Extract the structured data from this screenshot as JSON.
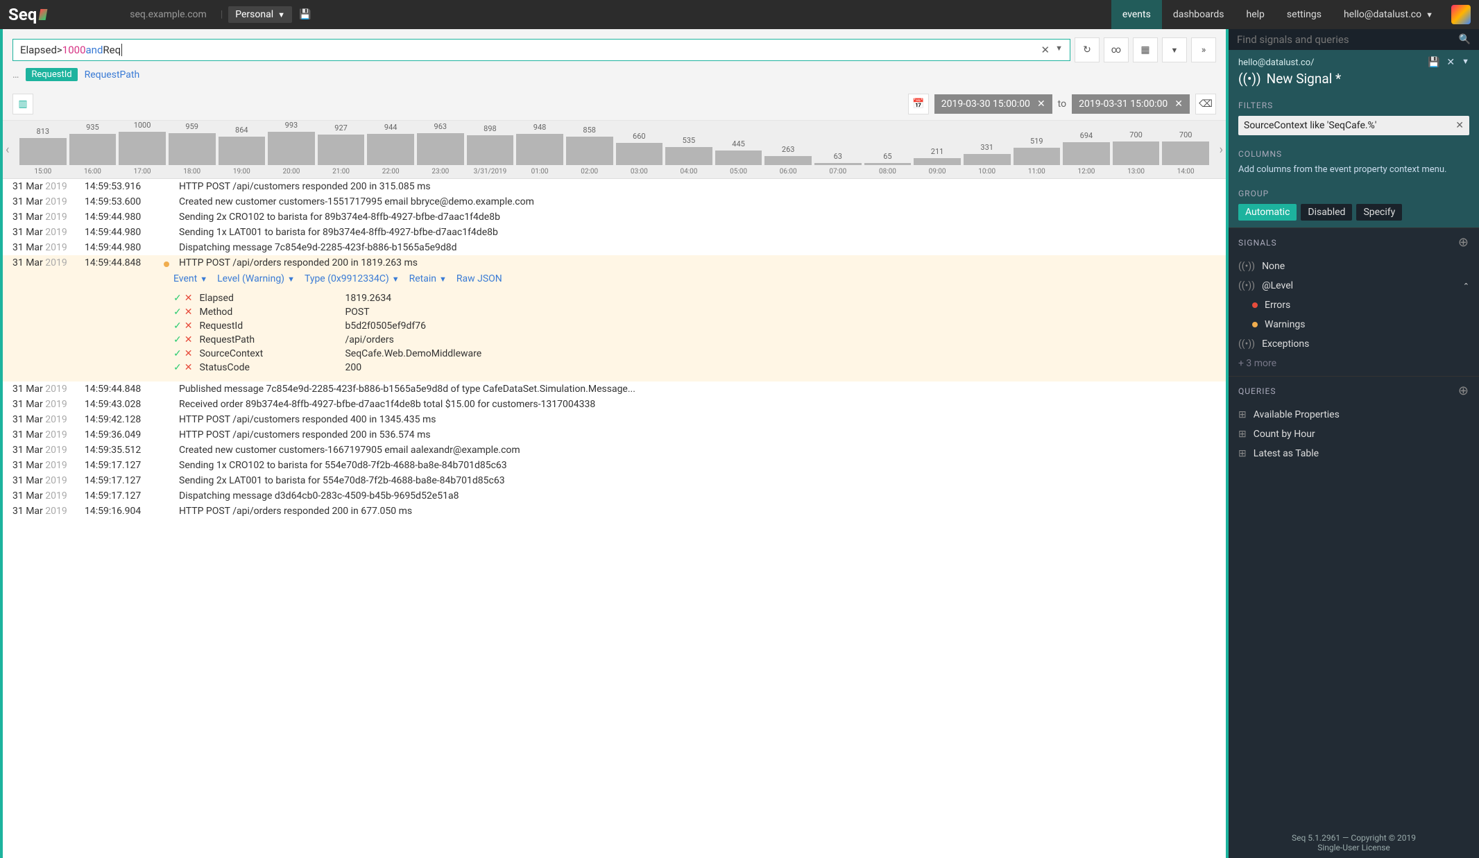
{
  "topnav": {
    "brand": "Seq",
    "host": "seq.example.com",
    "workspace": "Personal",
    "links": [
      "events",
      "dashboards",
      "help",
      "settings"
    ],
    "user": "hello@datalust.co"
  },
  "search": {
    "tokens": {
      "t1": "Elapsed ",
      "op": "> ",
      "num": "1000",
      "and": " and ",
      "t2": "Req"
    },
    "chips": {
      "pill": "RequestId",
      "link": "RequestPath"
    }
  },
  "dates": {
    "from": "2019-03-30 15:00:00",
    "to_label": "to",
    "to": "2019-03-31 15:00:00"
  },
  "chart_data": {
    "type": "bar",
    "categories": [
      "15:00",
      "16:00",
      "17:00",
      "18:00",
      "19:00",
      "20:00",
      "21:00",
      "22:00",
      "23:00",
      "3/31/2019",
      "01:00",
      "02:00",
      "03:00",
      "04:00",
      "05:00",
      "06:00",
      "07:00",
      "08:00",
      "09:00",
      "10:00",
      "11:00",
      "12:00",
      "13:00",
      "14:00"
    ],
    "values": [
      813,
      935,
      1000,
      959,
      864,
      993,
      927,
      944,
      963,
      898,
      948,
      858,
      660,
      535,
      445,
      263,
      63,
      65,
      211,
      331,
      519,
      694,
      700,
      700
    ],
    "title": "",
    "xlabel": "",
    "ylabel": "",
    "ylim": [
      0,
      1000
    ]
  },
  "events": [
    {
      "date": "31 Mar",
      "year": "2019",
      "time": "14:59:53.916",
      "level": null,
      "msg": "HTTP POST /api/customers responded 200 in 315.085 ms"
    },
    {
      "date": "31 Mar",
      "year": "2019",
      "time": "14:59:53.600",
      "level": null,
      "msg": "Created new customer customers-1551717995 email bbryce@demo.example.com"
    },
    {
      "date": "31 Mar",
      "year": "2019",
      "time": "14:59:44.980",
      "level": null,
      "msg": "Sending 2x CRO102 to barista for 89b374e4-8ffb-4927-bfbe-d7aac1f4de8b"
    },
    {
      "date": "31 Mar",
      "year": "2019",
      "time": "14:59:44.980",
      "level": null,
      "msg": "Sending 1x LAT001 to barista for 89b374e4-8ffb-4927-bfbe-d7aac1f4de8b"
    },
    {
      "date": "31 Mar",
      "year": "2019",
      "time": "14:59:44.980",
      "level": null,
      "msg": "Dispatching message 7c854e9d-2285-423f-b886-b1565a5e9d8d"
    },
    {
      "date": "31 Mar",
      "year": "2019",
      "time": "14:59:44.848",
      "level": "warn",
      "msg": "HTTP POST /api/orders responded 200 in 1819.263 ms",
      "expanded": true
    },
    {
      "date": "31 Mar",
      "year": "2019",
      "time": "14:59:44.848",
      "level": null,
      "msg": "Published message 7c854e9d-2285-423f-b886-b1565a5e9d8d of type CafeDataSet.Simulation.Message..."
    },
    {
      "date": "31 Mar",
      "year": "2019",
      "time": "14:59:43.028",
      "level": null,
      "msg": "Received order 89b374e4-8ffb-4927-bfbe-d7aac1f4de8b total $15.00 for customers-1317004338"
    },
    {
      "date": "31 Mar",
      "year": "2019",
      "time": "14:59:42.128",
      "level": null,
      "msg": "HTTP POST /api/customers responded 400 in 1345.435 ms"
    },
    {
      "date": "31 Mar",
      "year": "2019",
      "time": "14:59:36.049",
      "level": null,
      "msg": "HTTP POST /api/customers responded 200 in 536.574 ms"
    },
    {
      "date": "31 Mar",
      "year": "2019",
      "time": "14:59:35.512",
      "level": null,
      "msg": "Created new customer customers-1667197905 email aalexandr@example.com"
    },
    {
      "date": "31 Mar",
      "year": "2019",
      "time": "14:59:17.127",
      "level": null,
      "msg": "Sending 1x CRO102 to barista for 554e70d8-7f2b-4688-ba8e-84b701d85c63"
    },
    {
      "date": "31 Mar",
      "year": "2019",
      "time": "14:59:17.127",
      "level": null,
      "msg": "Sending 2x LAT001 to barista for 554e70d8-7f2b-4688-ba8e-84b701d85c63"
    },
    {
      "date": "31 Mar",
      "year": "2019",
      "time": "14:59:17.127",
      "level": null,
      "msg": "Dispatching message d3d64cb0-283c-4509-b45b-9695d52e51a8"
    },
    {
      "date": "31 Mar",
      "year": "2019",
      "time": "14:59:16.904",
      "level": null,
      "msg": "HTTP POST /api/orders responded 200 in 677.050 ms"
    }
  ],
  "expanded_actions": {
    "event": "Event",
    "level": "Level (Warning)",
    "type": "Type (0x9912334C)",
    "retain": "Retain",
    "raw": "Raw JSON"
  },
  "expanded_props": [
    {
      "name": "Elapsed",
      "value": "1819.2634"
    },
    {
      "name": "Method",
      "value": "POST"
    },
    {
      "name": "RequestId",
      "value": "b5d2f0505ef9df76"
    },
    {
      "name": "RequestPath",
      "value": "/api/orders"
    },
    {
      "name": "SourceContext",
      "value": "SeqCafe.Web.DemoMiddleware"
    },
    {
      "name": "StatusCode",
      "value": "200"
    }
  ],
  "right": {
    "search_placeholder": "Find signals and queries",
    "header_sub": "hello@datalust.co/",
    "signal_title": "New Signal *",
    "filters_label": "FILTERS",
    "filter_text": "SourceContext like 'SeqCafe.%'",
    "columns_label": "COLUMNS",
    "columns_hint": "Add columns from the event property context menu.",
    "group_label": "GROUP",
    "group_buttons": [
      "Automatic",
      "Disabled",
      "Specify"
    ],
    "signals_label": "SIGNALS",
    "signals": [
      {
        "label": "None",
        "icon": "signal"
      },
      {
        "label": "@Level",
        "icon": "signal",
        "open": true
      }
    ],
    "level_children": [
      {
        "label": "Errors",
        "dot": "err"
      },
      {
        "label": "Warnings",
        "dot": "warn"
      }
    ],
    "signals_more": [
      {
        "label": "Exceptions",
        "icon": "signal"
      }
    ],
    "signals_extra": "+ 3 more",
    "queries_label": "QUERIES",
    "queries": [
      "Available Properties",
      "Count by Hour",
      "Latest as Table"
    ],
    "footer1": "Seq 5.1.2961 — Copyright © 2019",
    "footer2": "Single-User License"
  }
}
